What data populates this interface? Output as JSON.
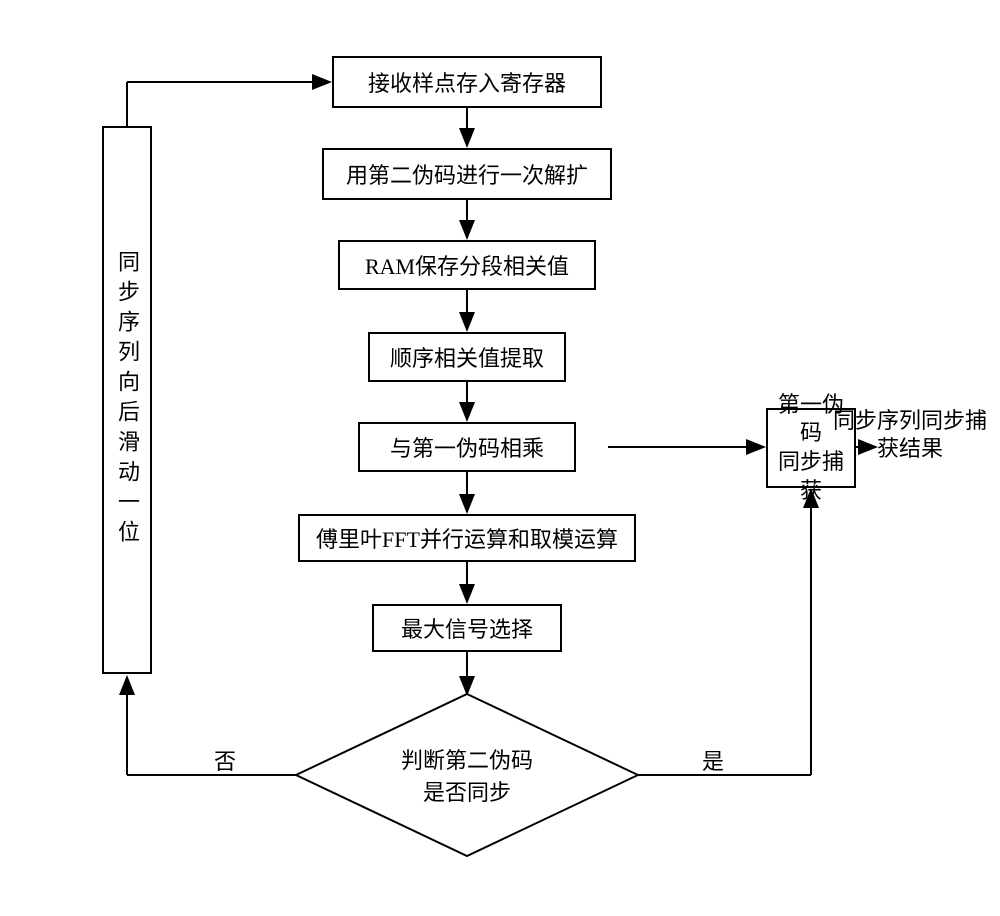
{
  "steps": {
    "s1": "接收样点存入寄存器",
    "s2": "用第二伪码进行一次解扩",
    "s3": "RAM保存分段相关值",
    "s4": "顺序相关值提取",
    "s5": "与第一伪码相乘",
    "s6": "傅里叶FFT并行运算和取模运算",
    "s7": "最大信号选择"
  },
  "sidebar": "同步序列向后滑动一位",
  "right_box": "第一伪码\n同步捕获",
  "decision_line1": "判断第二伪码",
  "decision_line2": "是否同步",
  "labels": {
    "no": "否",
    "yes": "是"
  },
  "output": "同步序列同步捕\n获结果"
}
